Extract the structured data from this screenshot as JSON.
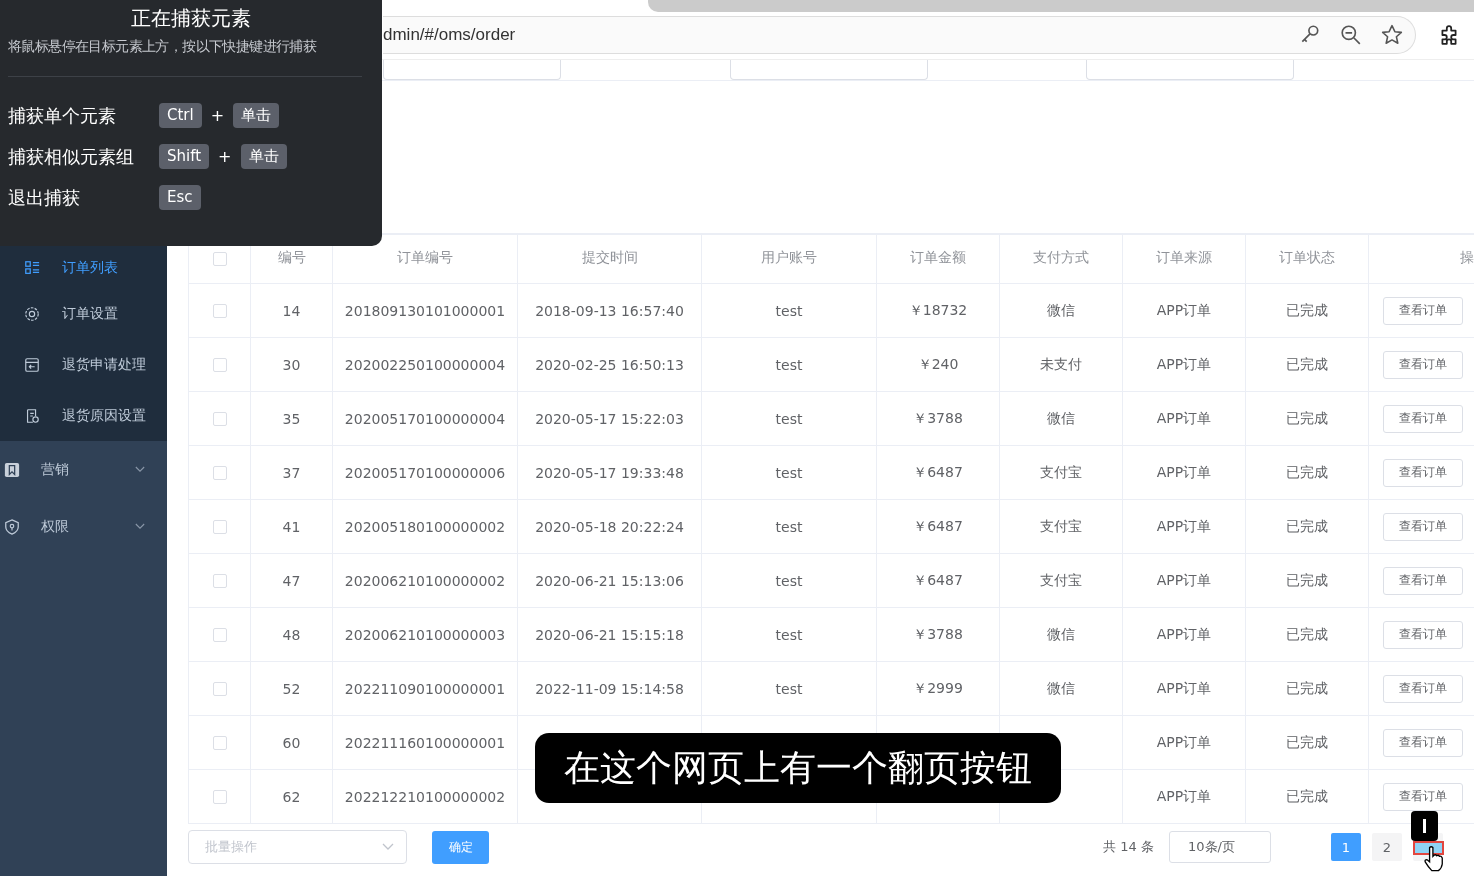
{
  "browser": {
    "url": "dmin/#/oms/order"
  },
  "capture_panel": {
    "title": "正在捕获元素",
    "hint": "将鼠标悬停在目标元素上方，按以下快捷键进行捕获",
    "shortcuts": [
      {
        "label": "捕获单个元素",
        "keys": [
          "Ctrl",
          "单击"
        ],
        "joiner": "+"
      },
      {
        "label": "捕获相似元素组",
        "keys": [
          "Shift",
          "单击"
        ],
        "joiner": "+"
      },
      {
        "label": "退出捕获",
        "keys": [
          "Esc"
        ]
      }
    ]
  },
  "sidebar": {
    "items": [
      {
        "label": "订单列表",
        "kind": "sub",
        "selected": true
      },
      {
        "label": "订单设置",
        "kind": "sub",
        "selected": false
      },
      {
        "label": "退货申请处理",
        "kind": "sub",
        "selected": false
      },
      {
        "label": "退货原因设置",
        "kind": "sub",
        "selected": false
      },
      {
        "label": "营销",
        "kind": "group",
        "selected": false
      },
      {
        "label": "权限",
        "kind": "group",
        "selected": false
      }
    ]
  },
  "table": {
    "header_checked": false,
    "columns": [
      "编号",
      "订单编号",
      "提交时间",
      "用户账号",
      "订单金额",
      "支付方式",
      "订单来源",
      "订单状态",
      "操"
    ],
    "rows": [
      {
        "checked": false,
        "cells": [
          "14",
          "201809130101000001",
          "2018-09-13 16:57:40",
          "test",
          "￥18732",
          "微信",
          "APP订单",
          "已完成"
        ],
        "action": "查看订单"
      },
      {
        "checked": false,
        "cells": [
          "30",
          "202002250100000004",
          "2020-02-25 16:50:13",
          "test",
          "￥240",
          "未支付",
          "APP订单",
          "已完成"
        ],
        "action": "查看订单"
      },
      {
        "checked": false,
        "cells": [
          "35",
          "202005170100000004",
          "2020-05-17 15:22:03",
          "test",
          "￥3788",
          "微信",
          "APP订单",
          "已完成"
        ],
        "action": "查看订单"
      },
      {
        "checked": false,
        "cells": [
          "37",
          "202005170100000006",
          "2020-05-17 19:33:48",
          "test",
          "￥6487",
          "支付宝",
          "APP订单",
          "已完成"
        ],
        "action": "查看订单"
      },
      {
        "checked": false,
        "cells": [
          "41",
          "202005180100000002",
          "2020-05-18 20:22:24",
          "test",
          "￥6487",
          "支付宝",
          "APP订单",
          "已完成"
        ],
        "action": "查看订单"
      },
      {
        "checked": false,
        "cells": [
          "47",
          "202006210100000002",
          "2020-06-21 15:13:06",
          "test",
          "￥6487",
          "支付宝",
          "APP订单",
          "已完成"
        ],
        "action": "查看订单"
      },
      {
        "checked": false,
        "cells": [
          "48",
          "202006210100000003",
          "2020-06-21 15:15:18",
          "test",
          "￥3788",
          "微信",
          "APP订单",
          "已完成"
        ],
        "action": "查看订单"
      },
      {
        "checked": false,
        "cells": [
          "52",
          "202211090100000001",
          "2022-11-09 15:14:58",
          "test",
          "￥2999",
          "微信",
          "APP订单",
          "已完成"
        ],
        "action": "查看订单"
      },
      {
        "checked": false,
        "cells": [
          "60",
          "202211160100000001",
          null,
          null,
          null,
          null,
          "APP订单",
          "已完成"
        ],
        "action": "查看订单"
      },
      {
        "checked": false,
        "cells": [
          "62",
          "202212210100000002",
          null,
          null,
          null,
          null,
          "APP订单",
          "已完成"
        ],
        "action": "查看订单"
      }
    ]
  },
  "batch": {
    "placeholder": "批量操作",
    "confirm": "确定"
  },
  "pagination": {
    "total": "共 14 条",
    "page_size": "10条/页",
    "pages": [
      {
        "label": "1",
        "selected": true
      },
      {
        "label": "2",
        "selected": false
      }
    ]
  },
  "subtitle": "在这个网页上有一个翻页按钮"
}
